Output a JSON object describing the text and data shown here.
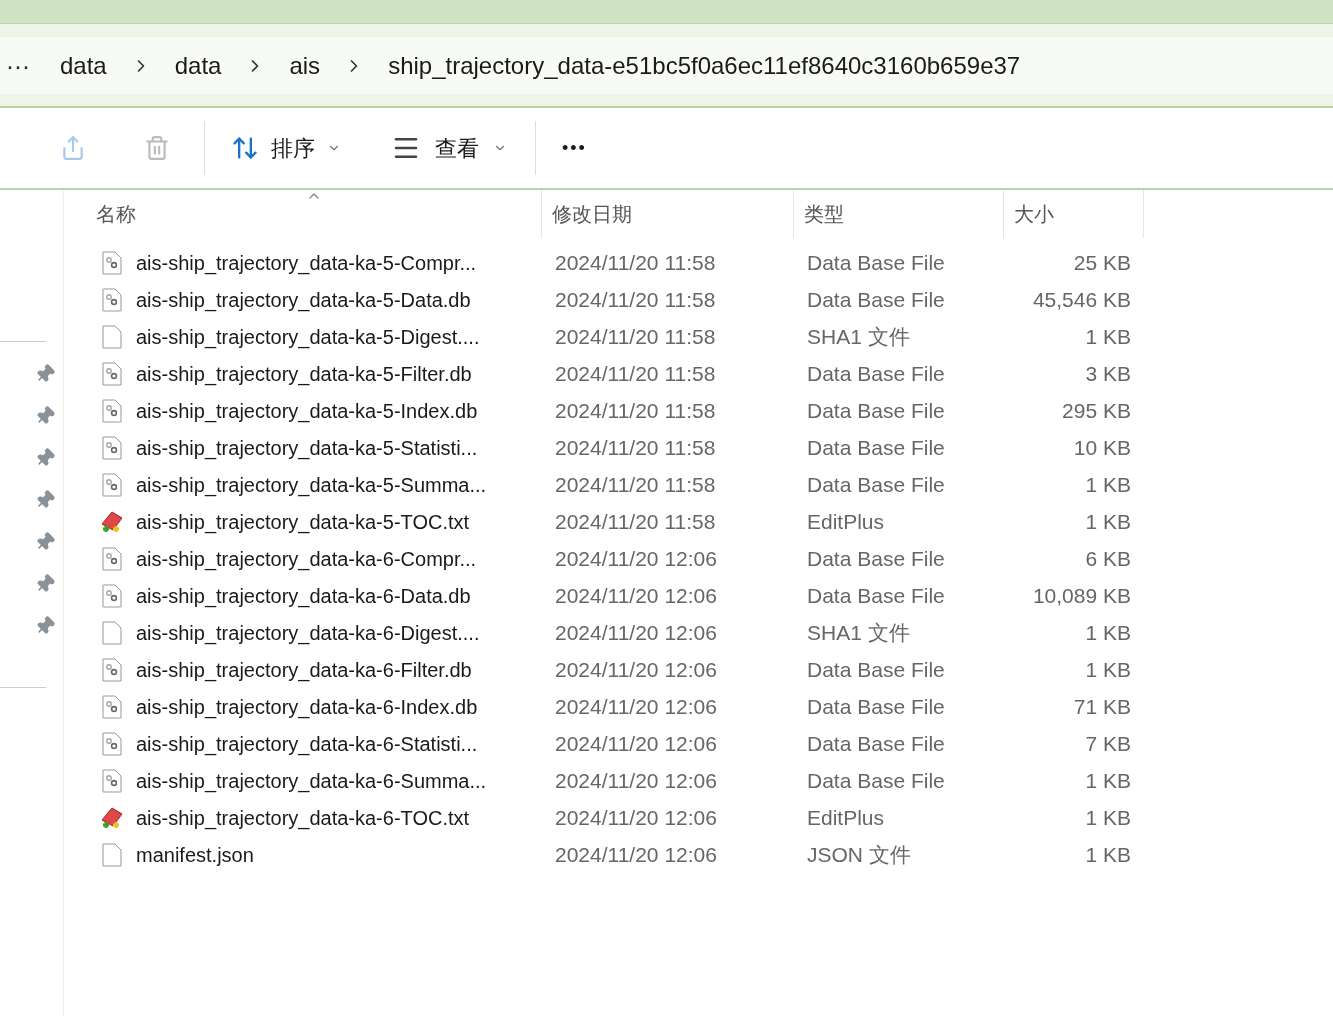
{
  "breadcrumb": {
    "more": "···",
    "items": [
      "data",
      "data",
      "ais",
      "ship_trajectory_data-e51bc5f0a6ec11ef8640c3160b659e37"
    ]
  },
  "toolbar": {
    "sort": "排序",
    "view": "查看",
    "more": "•••"
  },
  "columns": [
    "名称",
    "修改日期",
    "类型",
    "大小"
  ],
  "files": [
    {
      "kind": "db",
      "name": "ais-ship_trajectory_data-ka-5-Compr...",
      "date": "2024/11/20 11:58",
      "type": "Data Base File",
      "size": "25 KB"
    },
    {
      "kind": "db",
      "name": "ais-ship_trajectory_data-ka-5-Data.db",
      "date": "2024/11/20 11:58",
      "type": "Data Base File",
      "size": "45,546 KB"
    },
    {
      "kind": "blank",
      "name": "ais-ship_trajectory_data-ka-5-Digest....",
      "date": "2024/11/20 11:58",
      "type": "SHA1 文件",
      "size": "1 KB"
    },
    {
      "kind": "db",
      "name": "ais-ship_trajectory_data-ka-5-Filter.db",
      "date": "2024/11/20 11:58",
      "type": "Data Base File",
      "size": "3 KB"
    },
    {
      "kind": "db",
      "name": "ais-ship_trajectory_data-ka-5-Index.db",
      "date": "2024/11/20 11:58",
      "type": "Data Base File",
      "size": "295 KB"
    },
    {
      "kind": "db",
      "name": "ais-ship_trajectory_data-ka-5-Statisti...",
      "date": "2024/11/20 11:58",
      "type": "Data Base File",
      "size": "10 KB"
    },
    {
      "kind": "db",
      "name": "ais-ship_trajectory_data-ka-5-Summa...",
      "date": "2024/11/20 11:58",
      "type": "Data Base File",
      "size": "1 KB"
    },
    {
      "kind": "editplus",
      "name": "ais-ship_trajectory_data-ka-5-TOC.txt",
      "date": "2024/11/20 11:58",
      "type": "EditPlus",
      "size": "1 KB"
    },
    {
      "kind": "db",
      "name": "ais-ship_trajectory_data-ka-6-Compr...",
      "date": "2024/11/20 12:06",
      "type": "Data Base File",
      "size": "6 KB"
    },
    {
      "kind": "db",
      "name": "ais-ship_trajectory_data-ka-6-Data.db",
      "date": "2024/11/20 12:06",
      "type": "Data Base File",
      "size": "10,089 KB"
    },
    {
      "kind": "blank",
      "name": "ais-ship_trajectory_data-ka-6-Digest....",
      "date": "2024/11/20 12:06",
      "type": "SHA1 文件",
      "size": "1 KB"
    },
    {
      "kind": "db",
      "name": "ais-ship_trajectory_data-ka-6-Filter.db",
      "date": "2024/11/20 12:06",
      "type": "Data Base File",
      "size": "1 KB"
    },
    {
      "kind": "db",
      "name": "ais-ship_trajectory_data-ka-6-Index.db",
      "date": "2024/11/20 12:06",
      "type": "Data Base File",
      "size": "71 KB"
    },
    {
      "kind": "db",
      "name": "ais-ship_trajectory_data-ka-6-Statisti...",
      "date": "2024/11/20 12:06",
      "type": "Data Base File",
      "size": "7 KB"
    },
    {
      "kind": "db",
      "name": "ais-ship_trajectory_data-ka-6-Summa...",
      "date": "2024/11/20 12:06",
      "type": "Data Base File",
      "size": "1 KB"
    },
    {
      "kind": "editplus",
      "name": "ais-ship_trajectory_data-ka-6-TOC.txt",
      "date": "2024/11/20 12:06",
      "type": "EditPlus",
      "size": "1 KB"
    },
    {
      "kind": "blank",
      "name": "manifest.json",
      "date": "2024/11/20 12:06",
      "type": "JSON 文件",
      "size": "1 KB"
    }
  ]
}
